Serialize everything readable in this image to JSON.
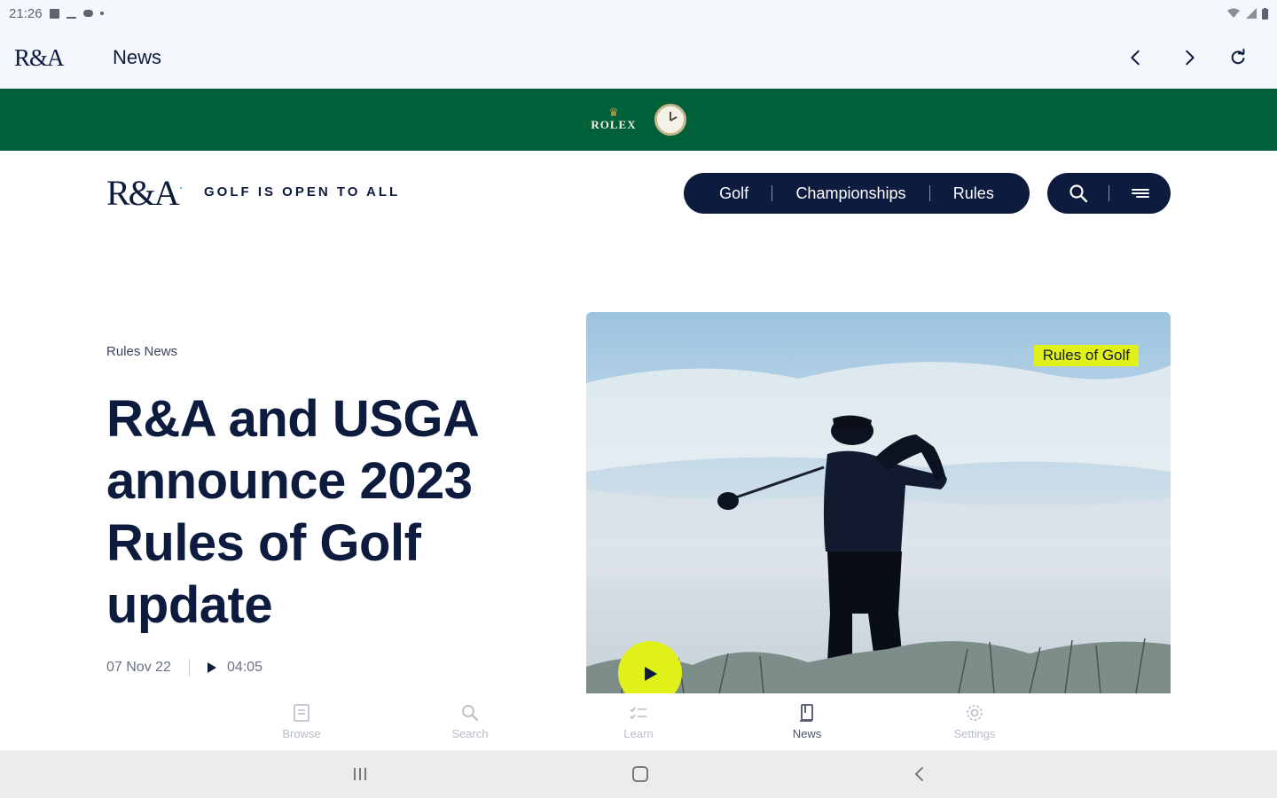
{
  "status_bar": {
    "time": "21:26"
  },
  "app_bar": {
    "logo": "R&A",
    "title": "News"
  },
  "sponsor": {
    "brand": "ROLEX"
  },
  "site_header": {
    "logo": "R&A",
    "tagline": "GOLF IS OPEN TO ALL",
    "nav": [
      "Golf",
      "Championships",
      "Rules"
    ]
  },
  "article": {
    "category": "Rules News",
    "headline": "R&A and USGA announce 2023 Rules of Golf update",
    "date": "07 Nov 22",
    "duration": "04:05",
    "image_tag": "Rules of Golf"
  },
  "bottom_nav": {
    "items": [
      "Browse",
      "Search",
      "Learn",
      "News",
      "Settings"
    ],
    "active": "News"
  },
  "colors": {
    "navy": "#0d1b3e",
    "rolex_green": "#006039",
    "accent_yellow": "#e2f019",
    "logo_tick": "#3ab0e2"
  },
  "icons": {
    "back": "chevron-left-icon",
    "forward": "chevron-right-icon",
    "reload": "refresh-icon",
    "search": "search-icon",
    "menu": "menu-icon",
    "play": "play-icon"
  }
}
